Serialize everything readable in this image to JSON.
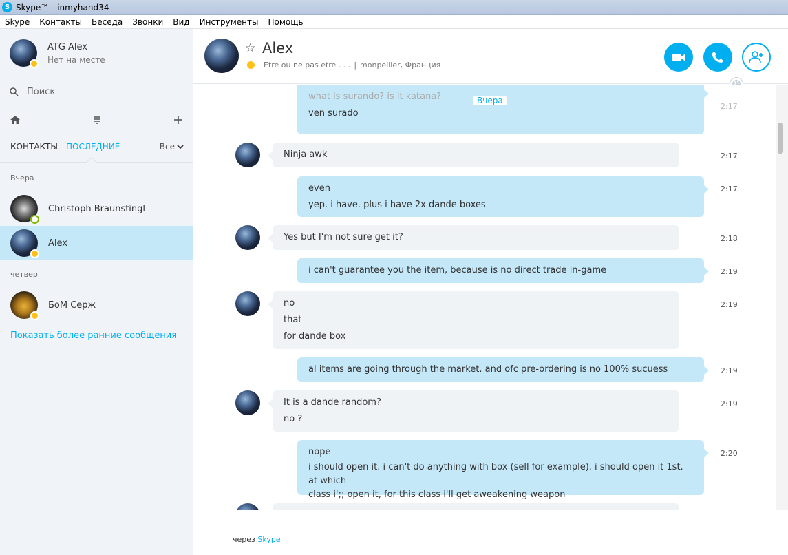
{
  "window": {
    "title": "Skype™ - inmyhand34"
  },
  "menu": [
    "Skype",
    "Контакты",
    "Беседа",
    "Звонки",
    "Вид",
    "Инструменты",
    "Помощь"
  ],
  "profile": {
    "name": "ATG Alex",
    "mood": "Нет на месте"
  },
  "search": {
    "placeholder": "Поиск"
  },
  "tabs": {
    "contacts": "КОНТАКТЫ",
    "recent": "ПОСЛЕДНИЕ",
    "filter": "Все"
  },
  "groups": {
    "yesterday": "Вчера",
    "thursday": "четвер"
  },
  "contacts": [
    {
      "name": "Christoph Braunstingl",
      "status": "online"
    },
    {
      "name": "Alex",
      "status": "away"
    },
    {
      "name": "БоМ Серж",
      "status": "away"
    }
  ],
  "show_earlier": "Показать более ранние сообщения",
  "chat": {
    "name": "Alex",
    "mood": "Etre ou ne pas etre . . .",
    "separator": "|",
    "location": "monpellier, Франция",
    "day_label": "Вчера"
  },
  "messages": [
    {
      "dir": "out",
      "lines": [
        "what is surando? is it katana?",
        "ven surado"
      ],
      "time": "2:17"
    },
    {
      "dir": "in",
      "lines": [
        "Ninja awk"
      ],
      "time": "2:17"
    },
    {
      "dir": "out",
      "lines": [
        "even",
        "yep. i have. plus i have 2x dande boxes"
      ],
      "time": "2:17"
    },
    {
      "dir": "in",
      "lines": [
        "Yes but I'm not sure get it?"
      ],
      "time": "2:18"
    },
    {
      "dir": "out",
      "lines": [
        "i can't guarantee you the item, because is no direct trade in-game"
      ],
      "time": "2:19"
    },
    {
      "dir": "in",
      "lines": [
        "no",
        "that",
        "for dande box"
      ],
      "time": "2:19"
    },
    {
      "dir": "out",
      "lines": [
        "al items are going through the market. and ofc pre-ordering is no 100% sucuess"
      ],
      "time": "2:19"
    },
    {
      "dir": "in",
      "lines": [
        "It is a dande random?",
        "no ?"
      ],
      "time": "2:19"
    },
    {
      "dir": "out",
      "lines": [
        "nope",
        "i should open it. i can't do anything with box (sell for example). i should open it 1st. at which",
        "class i';; open it, for this class i'll get aweakening weapon"
      ],
      "time": "2:20"
    }
  ],
  "footer": {
    "via": "через",
    "via_link": "Skype"
  },
  "colors": {
    "accent": "#00aff0",
    "away": "#ffc01a",
    "online": "#7fba00",
    "outgoing_bubble": "#c5e8f9",
    "incoming_bubble": "#f0f3f6"
  }
}
